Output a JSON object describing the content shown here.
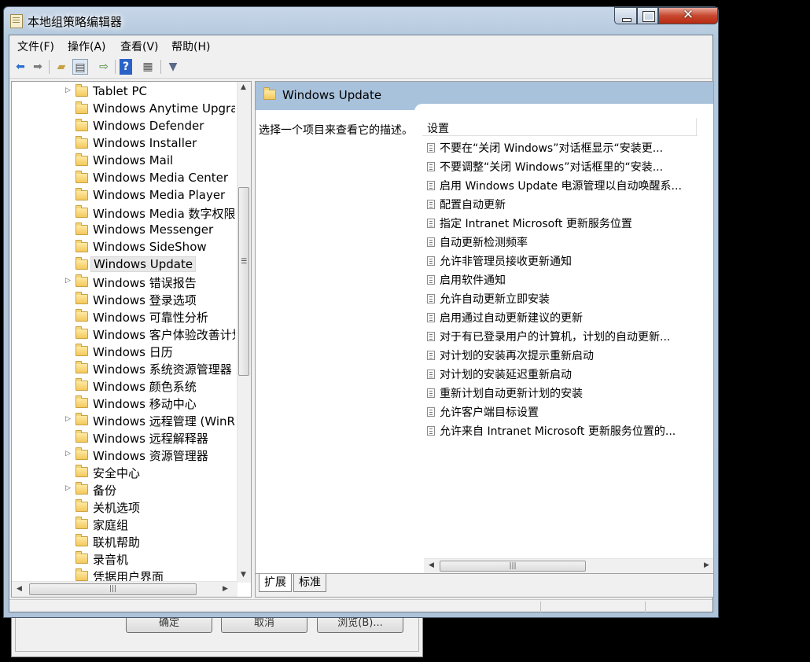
{
  "window": {
    "title": "本地组策略编辑器"
  },
  "background_dialog": {
    "buttons": [
      "确定",
      "取消",
      "浏览(B)..."
    ]
  },
  "menu": [
    "文件(F)",
    "操作(A)",
    "查看(V)",
    "帮助(H)"
  ],
  "toolbar_icons": [
    "back-arrow-icon",
    "forward-arrow-icon",
    "up-folder-icon",
    "show-hide-tree-icon",
    "export-list-icon",
    "help-icon",
    "properties-icon",
    "filter-icon"
  ],
  "tree": {
    "items": [
      {
        "label": "Tablet PC",
        "expandable": true,
        "selected": false
      },
      {
        "label": "Windows Anytime Upgrade",
        "expandable": false,
        "selected": false
      },
      {
        "label": "Windows Defender",
        "expandable": false,
        "selected": false
      },
      {
        "label": "Windows Installer",
        "expandable": false,
        "selected": false
      },
      {
        "label": "Windows Mail",
        "expandable": false,
        "selected": false
      },
      {
        "label": "Windows Media Center",
        "expandable": false,
        "selected": false
      },
      {
        "label": "Windows Media Player",
        "expandable": false,
        "selected": false
      },
      {
        "label": "Windows Media 数字权限管理",
        "expandable": false,
        "selected": false
      },
      {
        "label": "Windows Messenger",
        "expandable": false,
        "selected": false
      },
      {
        "label": "Windows SideShow",
        "expandable": false,
        "selected": false
      },
      {
        "label": "Windows Update",
        "expandable": false,
        "selected": true
      },
      {
        "label": "Windows 错误报告",
        "expandable": true,
        "selected": false
      },
      {
        "label": "Windows 登录选项",
        "expandable": false,
        "selected": false
      },
      {
        "label": "Windows 可靠性分析",
        "expandable": false,
        "selected": false
      },
      {
        "label": "Windows 客户体验改善计划",
        "expandable": false,
        "selected": false
      },
      {
        "label": "Windows 日历",
        "expandable": false,
        "selected": false
      },
      {
        "label": "Windows 系统资源管理器",
        "expandable": false,
        "selected": false
      },
      {
        "label": "Windows 颜色系统",
        "expandable": false,
        "selected": false
      },
      {
        "label": "Windows 移动中心",
        "expandable": false,
        "selected": false
      },
      {
        "label": "Windows 远程管理 (WinRM)",
        "expandable": true,
        "selected": false
      },
      {
        "label": "Windows 远程解释器",
        "expandable": false,
        "selected": false
      },
      {
        "label": "Windows 资源管理器",
        "expandable": true,
        "selected": false
      },
      {
        "label": "安全中心",
        "expandable": false,
        "selected": false
      },
      {
        "label": "备份",
        "expandable": true,
        "selected": false
      },
      {
        "label": "关机选项",
        "expandable": false,
        "selected": false
      },
      {
        "label": "家庭组",
        "expandable": false,
        "selected": false
      },
      {
        "label": "联机帮助",
        "expandable": false,
        "selected": false
      },
      {
        "label": "录音机",
        "expandable": false,
        "selected": false
      },
      {
        "label": "凭据用户界面",
        "expandable": false,
        "selected": false
      }
    ]
  },
  "right_panel": {
    "header_title": "Windows Update",
    "description": "选择一个项目来查看它的描述。",
    "column_header": "设置",
    "settings": [
      "不要在“关闭 Windows”对话框显示“安装更...",
      "不要调整“关闭 Windows”对话框里的“安装...",
      "启用 Windows Update 电源管理以自动唤醒系...",
      "配置自动更新",
      "指定 Intranet Microsoft 更新服务位置",
      "自动更新检测频率",
      "允许非管理员接收更新通知",
      "启用软件通知",
      "允许自动更新立即安装",
      "启用通过自动更新建议的更新",
      "对于有已登录用户的计算机，计划的自动更新...",
      "对计划的安装再次提示重新启动",
      "对计划的安装延迟重新启动",
      "重新计划自动更新计划的安装",
      "允许客户端目标设置",
      "允许来自 Intranet Microsoft 更新服务位置的..."
    ],
    "tabs": [
      "扩展",
      "标准"
    ]
  }
}
